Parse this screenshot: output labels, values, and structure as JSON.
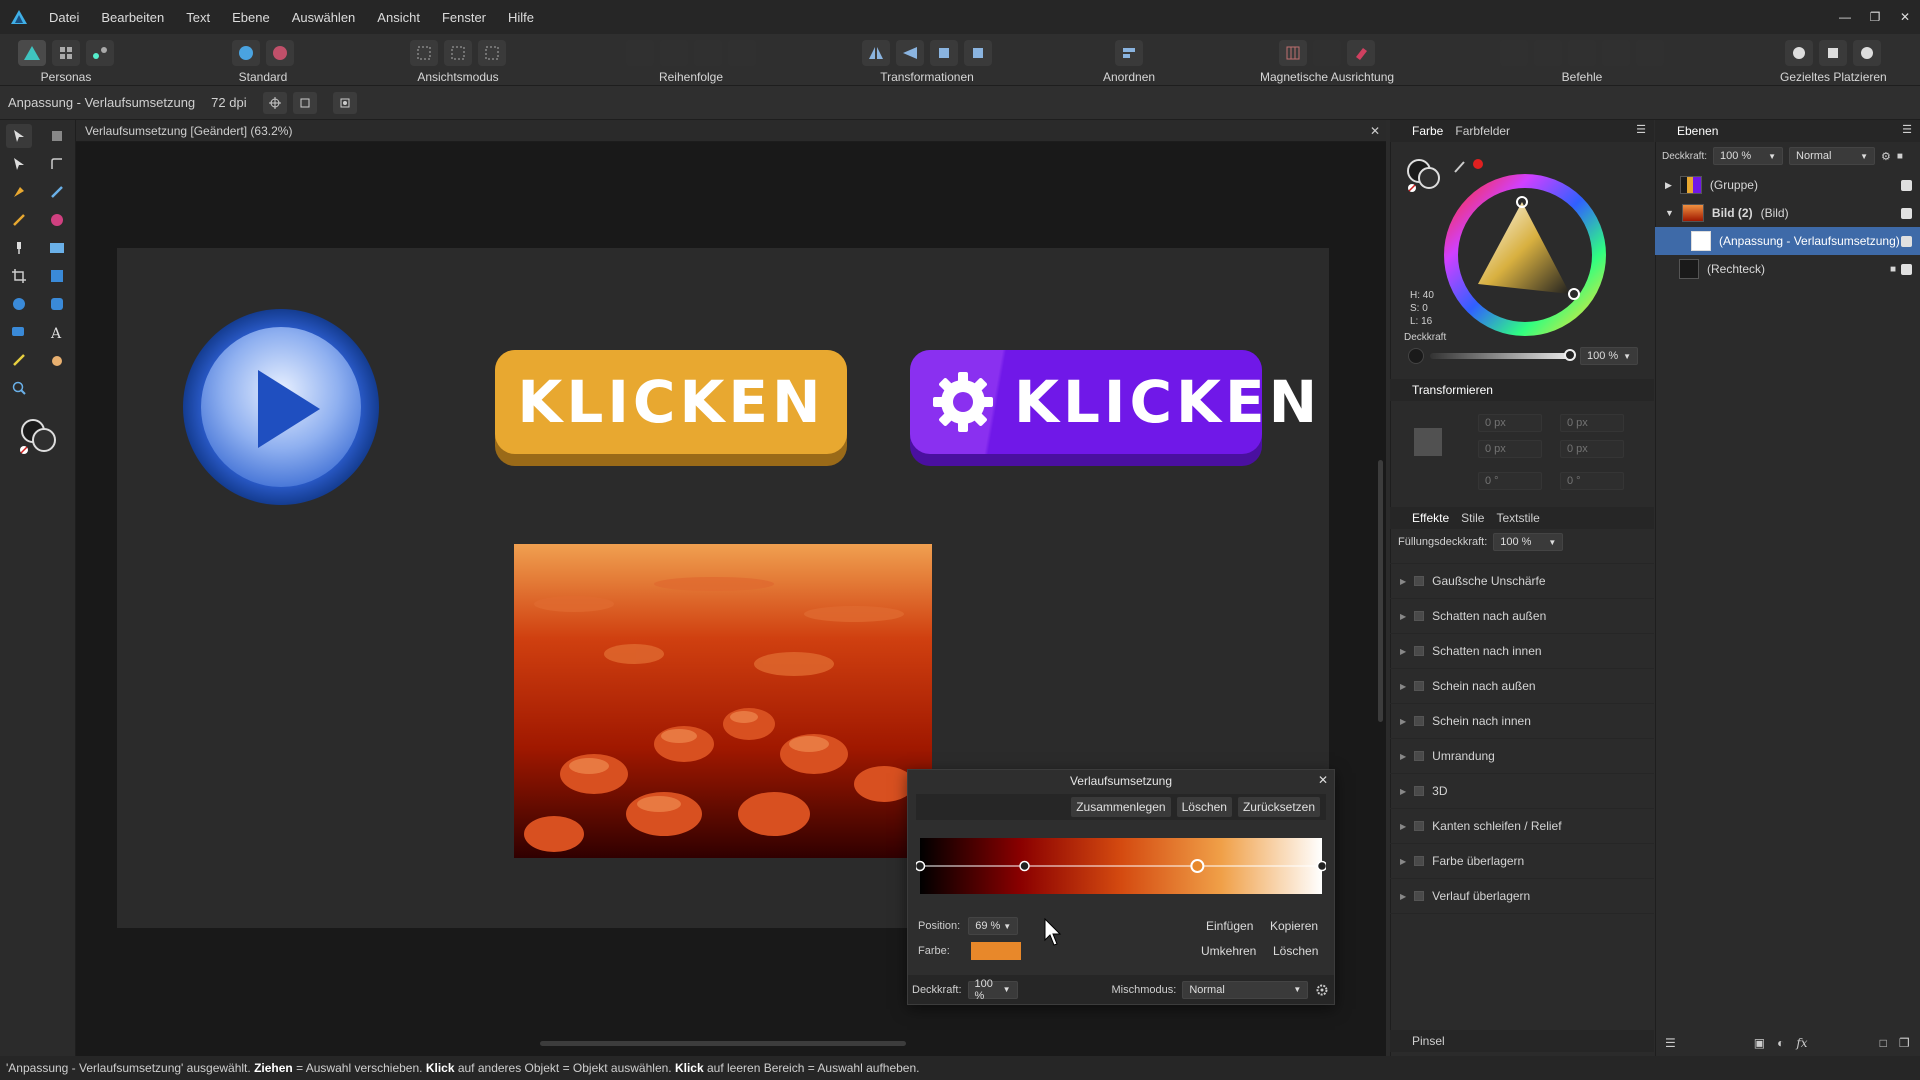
{
  "menu": [
    "Datei",
    "Bearbeiten",
    "Text",
    "Ebene",
    "Auswählen",
    "Ansicht",
    "Fenster",
    "Hilfe"
  ],
  "toolbar": {
    "personas": "Personas",
    "standard": "Standard",
    "ansichtsmodus": "Ansichtsmodus",
    "reihenfolge": "Reihenfolge",
    "transformationen": "Transformationen",
    "anordnen": "Anordnen",
    "magnetisch": "Magnetische Ausrichtung",
    "befehle": "Befehle",
    "gezieltes": "Gezieltes Platzieren"
  },
  "context": {
    "layer_name": "Anpassung - Verlaufsumsetzung",
    "dpi": "72 dpi"
  },
  "document": {
    "tab_title": "Verlaufsumsetzung [Geändert] (63.2%)"
  },
  "canvas": {
    "button1_label": "KLICKEN",
    "button2_label": "KLICKEN"
  },
  "color_panel": {
    "tabs": [
      "Farbe",
      "Farbfelder"
    ],
    "h": "H: 40",
    "s": "S: 0",
    "l": "L: 16",
    "opacity_label": "Deckkraft",
    "opacity_value": "100 %"
  },
  "transform_panel": {
    "title": "Transformieren",
    "x": "0 px",
    "y": "0 px",
    "w": "0 px",
    "h": "0 px",
    "r": "0 °",
    "s": "0 °"
  },
  "effects_panel": {
    "tabs": [
      "Effekte",
      "Stile",
      "Textstile"
    ],
    "fill_opacity_label": "Füllungsdeckkraft:",
    "fill_opacity_value": "100 %",
    "effects": [
      "Gaußsche Unschärfe",
      "Schatten nach außen",
      "Schatten nach innen",
      "Schein nach außen",
      "Schein nach innen",
      "Umrandung",
      "3D",
      "Kanten schleifen / Relief",
      "Farbe überlagern",
      "Verlauf überlagern"
    ]
  },
  "brush_panel": {
    "title": "Pinsel"
  },
  "layers_panel": {
    "title": "Ebenen",
    "opacity_label": "Deckkraft:",
    "opacity_value": "100 %",
    "blend": "Normal",
    "layers": [
      {
        "name": "(Gruppe)"
      },
      {
        "name": "Bild (2)",
        "suffix": "(Bild)"
      },
      {
        "name": "(Anpassung - Verlaufsumsetzung)"
      },
      {
        "name": "(Rechteck)"
      }
    ]
  },
  "gradient_dialog": {
    "title": "Verlaufsumsetzung",
    "merge": "Zusammenlegen",
    "delete_top": "Löschen",
    "reset": "Zurücksetzen",
    "position_label": "Position:",
    "position_value": "69 %",
    "color_label": "Farbe:",
    "insert": "Einfügen",
    "copy": "Kopieren",
    "invert": "Umkehren",
    "delete": "Löschen",
    "opacity_label": "Deckkraft:",
    "opacity_value": "100 %",
    "blend_label": "Mischmodus:",
    "blend_value": "Normal",
    "stops": [
      0,
      0.26,
      0.69,
      1
    ],
    "selected_stop": 0.69,
    "selected_color": "#e8882a",
    "gradient_colors": [
      "#000000",
      "#8a0000",
      "#d44a10",
      "#f0a048",
      "#ffffff"
    ]
  },
  "status": {
    "t1": "'Anpassung - Verlaufsumsetzung' ausgewählt. ",
    "b1": "Ziehen",
    "t2": " = Auswahl verschieben. ",
    "b2": "Klick",
    "t3": " auf anderes Objekt = Objekt auswählen. ",
    "b3": "Klick",
    "t4": " auf leeren Bereich = Auswahl aufheben."
  },
  "colors": {
    "accent": "#3e6aa8",
    "button_yellow": "#e8a830",
    "button_purple": "#7a1ff0"
  }
}
